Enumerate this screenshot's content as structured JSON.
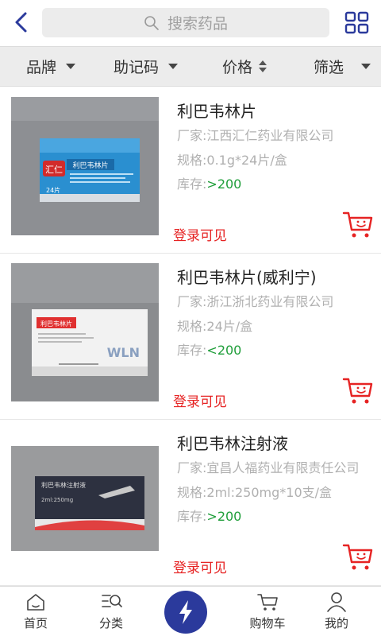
{
  "header": {
    "search_placeholder": "搜索药品",
    "accent_color": "#2b3a9c"
  },
  "filters": [
    {
      "label": "品牌",
      "indicator": "dropdown"
    },
    {
      "label": "助记码",
      "indicator": "dropdown"
    },
    {
      "label": "价格",
      "indicator": "sort"
    },
    {
      "label": "筛选",
      "indicator": "dropdown"
    }
  ],
  "products": [
    {
      "name": "利巴韦林片",
      "manufacturer": "厂家:江西汇仁药业有限公司",
      "spec": "规格:0.1g*24片/盒",
      "stock_label": "库存:",
      "stock_value": ">200",
      "login_hint": "登录可见",
      "box_brand": "汇仁",
      "box_title": "利巴韦林片",
      "box_count": "24片"
    },
    {
      "name": "利巴韦林片(威利宁)",
      "manufacturer": "厂家:浙江浙北药业有限公司",
      "spec": "规格:24片/盒",
      "stock_label": "库存:",
      "stock_value": "<200",
      "login_hint": "登录可见",
      "box_title": "利巴韦林片",
      "box_brand": "WLN"
    },
    {
      "name": "利巴韦林注射液",
      "manufacturer": "厂家:宜昌人福药业有限责任公司",
      "spec": "规格:2ml:250mg*10支/盒",
      "stock_label": "库存:",
      "stock_value": ">200",
      "login_hint": "登录可见",
      "box_title": "利巴韦林注射液",
      "box_dose": "2ml:250mg"
    }
  ],
  "tabbar": {
    "items": [
      {
        "label": "首页",
        "icon": "home-icon"
      },
      {
        "label": "分类",
        "icon": "category-icon"
      },
      {
        "label": "",
        "icon": "lightning-icon"
      },
      {
        "label": "购物车",
        "icon": "cart-icon"
      },
      {
        "label": "我的",
        "icon": "user-icon"
      }
    ]
  }
}
